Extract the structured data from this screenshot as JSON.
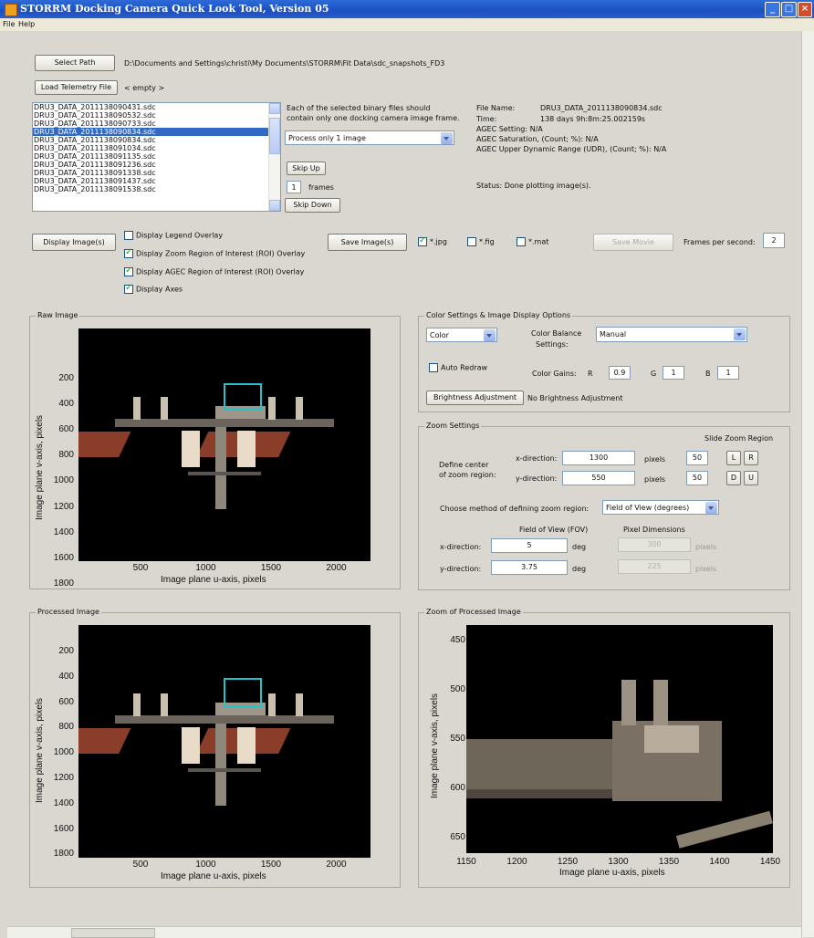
{
  "window": {
    "title": "STORRM Docking Camera Quick Look Tool, Version 05"
  },
  "menu": [
    "File",
    "Help"
  ],
  "top": {
    "select_path_label": "Select Path",
    "path_value": "D:\\Documents and Settings\\christi\\My Documents\\STORRM\\Fit Data\\sdc_snapshots_FD3",
    "load_telemetry_label": "Load Telemetry File",
    "telemetry_value": "< empty >"
  },
  "file_list": {
    "items": [
      "DRU3_DATA_2011138090431.sdc",
      "DRU3_DATA_2011138090532.sdc",
      "DRU3_DATA_2011138090733.sdc",
      "DRU3_DATA_2011138090834.sdc",
      "DRU3_DATA_2011138090834.sdc",
      "DRU3_DATA_2011138091034.sdc",
      "DRU3_DATA_2011138091135.sdc",
      "DRU3_DATA_2011138091236.sdc",
      "DRU3_DATA_2011138091338.sdc",
      "DRU3_DATA_2011138091437.sdc",
      "DRU3_DATA_2011138091538.sdc"
    ],
    "selected_index": 3
  },
  "frame_opts": {
    "note_line1": "Each of the selected binary files should",
    "note_line2": "contain only one docking camera image frame.",
    "process_select": "Process only 1 image",
    "skip_up": "Skip Up",
    "frames_value": "1",
    "frames_label": "frames",
    "skip_down": "Skip Down"
  },
  "file_info": {
    "name_label": "File Name:",
    "name_value": "DRU3_DATA_2011138090834.sdc",
    "time_label": "Time:",
    "time_value": "138 days 9h:8m:25.002159s",
    "agec_setting": "AGEC Setting:",
    "agec_setting_value": "N/A",
    "agec_saturation": "AGEC Saturation, (Count; %):",
    "agec_saturation_value": "N/A",
    "agec_udr": "AGEC Upper Dynamic Range (UDR), (Count; %):",
    "agec_udr_value": "N/A",
    "status_label": "Status:",
    "status_value": "Done plotting image(s)."
  },
  "display": {
    "display_images": "Display Image(s)",
    "legend_overlay": "Display Legend Overlay",
    "zoom_roi_overlay": "Display Zoom Region of Interest (ROI) Overlay",
    "agec_roi_overlay": "Display AGEC Region of Interest (ROI) Overlay",
    "display_axes": "Display Axes",
    "save_images": "Save Image(s)",
    "jpg": "*.jpg",
    "fig": "*.fig",
    "mat": "*.mat",
    "save_movie": "Save Movie",
    "fps_label": "Frames per second:",
    "fps_value": "2"
  },
  "raw_panel": {
    "title": "Raw Image",
    "yticks": [
      "200",
      "400",
      "600",
      "800",
      "1000",
      "1200",
      "1400",
      "1600",
      "1800"
    ],
    "xticks": [
      "500",
      "1000",
      "1500",
      "2000"
    ],
    "xlabel": "Image plane u-axis, pixels",
    "ylabel": "Image plane v-axis, pixels"
  },
  "processed_panel": {
    "title": "Processed Image",
    "yticks": [
      "200",
      "400",
      "600",
      "800",
      "1000",
      "1200",
      "1400",
      "1600",
      "1800"
    ],
    "xticks": [
      "500",
      "1000",
      "1500",
      "2000"
    ],
    "xlabel": "Image plane u-axis, pixels",
    "ylabel": "Image plane v-axis, pixels"
  },
  "color_settings": {
    "title": "Color Settings & Image Display Options",
    "mode_select": "Color",
    "balance_label_1": "Color Balance",
    "balance_label_2": "Settings:",
    "balance_select": "Manual",
    "auto_redraw": "Auto Redraw",
    "gains_label": "Color Gains:",
    "r_label": "R",
    "r_value": "0.9",
    "g_label": "G",
    "g_value": "1",
    "b_label": "B",
    "b_value": "1",
    "brightness_button": "Brightness Adjustment",
    "brightness_status": "No Brightness Adjustment"
  },
  "zoom_settings": {
    "title": "Zoom Settings",
    "slide_label": "Slide Zoom Region",
    "define_center_1": "Define center",
    "define_center_2": "of zoom region:",
    "x_dir": "x-direction:",
    "x_value": "1300",
    "y_dir": "y-direction:",
    "y_value": "550",
    "pixels": "pixels",
    "slide_x": "50",
    "slide_y": "50",
    "L": "L",
    "R": "R",
    "D": "D",
    "U": "U",
    "method_label": "Choose method of defining zoom region:",
    "method_select": "Field of View (degrees)",
    "fov_header": "Field of View (FOV)",
    "pixdim_header": "Pixel Dimensions",
    "fov_x_label": "x-direction:",
    "fov_x_value": "5",
    "fov_y_label": "y-direction:",
    "fov_y_value": "3.75",
    "deg": "deg",
    "pix_x_value": "300",
    "pix_y_value": "225"
  },
  "zoom_panel": {
    "title": "Zoom of Processed Image",
    "yticks": [
      "450",
      "500",
      "550",
      "600",
      "650"
    ],
    "xticks": [
      "1150",
      "1200",
      "1250",
      "1300",
      "1350",
      "1400",
      "1450"
    ],
    "xlabel": "Image plane u-axis, pixels",
    "ylabel": "Image plane v-axis, pixels"
  }
}
